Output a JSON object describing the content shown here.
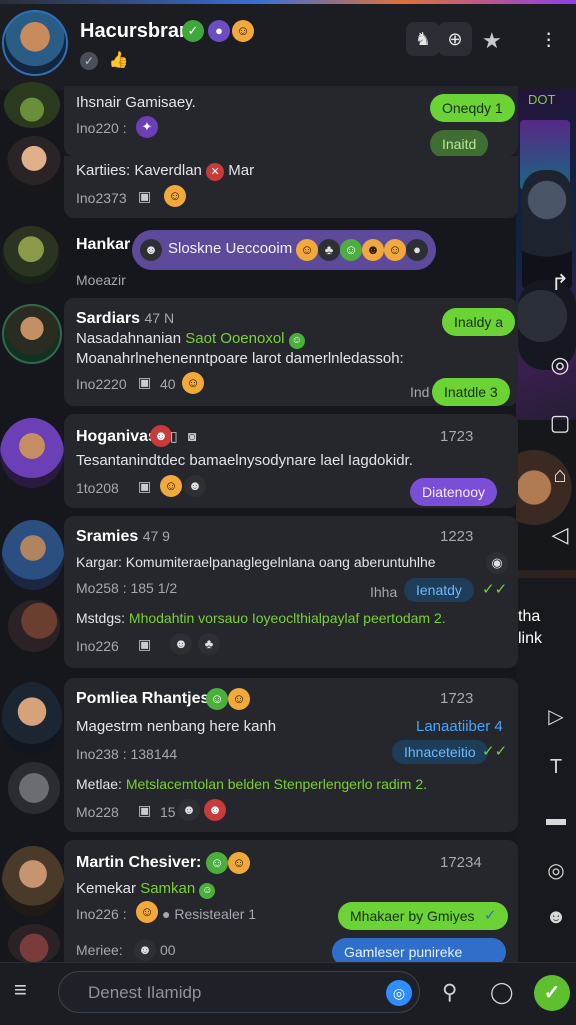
{
  "header": {
    "title": "Hacursbran",
    "subtitle_icons": [
      "check-icon",
      "thumb-icon"
    ],
    "badges": [
      "green-badge",
      "orange-badge"
    ]
  },
  "right_panel": {
    "label_top": "DOT",
    "text_lines": [
      "tha",
      "link"
    ]
  },
  "chats": [
    {
      "text": "Ihsnair Gamisaey.",
      "meta": "Ino220 :",
      "pill1": "Oneqdy 1",
      "pill2": "Inaitd"
    },
    {
      "text_a": "Kartiies:",
      "text_b": "Kaverdlan",
      "text_c": "Mar",
      "meta": "Ino2373"
    },
    {
      "name": "Hankar",
      "pill": "Sloskne Ueccooim",
      "meta": "Moeazir"
    },
    {
      "name": "Sardiars",
      "name_suffix": "47 N",
      "line1_a": "Nasadahnanian",
      "line1_b": "Saot Ooenoxol",
      "line2": "Moanahrlnehenenntpoare larot damerlnledassoh:",
      "meta": "Ino2220",
      "meta_num": "40",
      "pill1": "Inaldy a",
      "pill2": "Inatdle 3",
      "pill2_prefix": "Ind"
    },
    {
      "name": "Hoganivas",
      "time": "1723",
      "line1": "Tesantanindtdec bamaelnysodynare lael Iagdokidr.",
      "meta": "1to208",
      "pill": "Diatenooy"
    },
    {
      "name": "Sramies",
      "name_suffix": "47 9",
      "time": "1223",
      "line1": "Kargar: Komumiteraelpanaglegelnlana oang aberuntuhlhe",
      "meta1": "Mo258 : 185 1/2",
      "pill_prefix": "Ihha",
      "pill": "Ienatdy",
      "line2_label": "Mstdgs:",
      "line2": "Mhodahtin vorsauo Ioyeoclthialpaylaf peertodam",
      "line2_num": "2.",
      "meta2": "Ino226"
    },
    {
      "name": "Pomliea Rhantjes:",
      "time": "1723",
      "line1": "Magestrm nenbang here kanh",
      "line1_right": "Lanaatiiber 4",
      "meta1": "Ino238 : 138144",
      "pill": "Ihnaceteitio",
      "line2_label": "Metlae:",
      "line2": "Metslacemtolan belden Stenperlengerlo radim",
      "line2_num": "2.",
      "meta2": "Mo228",
      "meta2_num": "15"
    },
    {
      "name": "Martin Chesiver:",
      "time": "17234",
      "line1_a": "Kemekar",
      "line1_b": "Samkan",
      "meta1": "Ino226 :",
      "meta1_b": "Resistealer 1",
      "pill1": "Mhakaer by Gmiyes",
      "line2_label": "Meriee:",
      "line2_num": "00",
      "pill2": "Gamleser punireke"
    }
  ],
  "composer": {
    "placeholder": "Denest Ilamidp"
  },
  "colors": {
    "accent_green": "#6bd336",
    "accent_purple": "#7a4ed6",
    "accent_blue": "#2f6ec9",
    "background": "#15171c",
    "card": "#25272d"
  }
}
